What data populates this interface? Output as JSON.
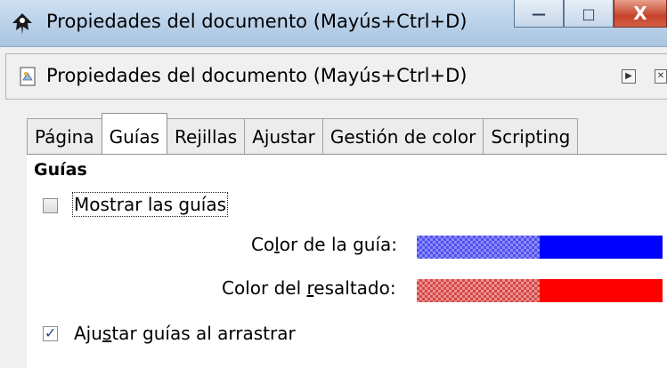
{
  "window": {
    "title": "Propiedades del documento (Mayús+Ctrl+D)",
    "buttons": {
      "minimize": "—",
      "maximize": "□",
      "close": "X"
    }
  },
  "panel": {
    "title": "Propiedades del documento (Mayús+Ctrl+D)"
  },
  "tabs": [
    {
      "label": "Página",
      "active": false
    },
    {
      "label": "Guías",
      "active": true
    },
    {
      "label": "Rejillas",
      "active": false
    },
    {
      "label": "Ajustar",
      "active": false
    },
    {
      "label": "Gestión de color",
      "active": false
    },
    {
      "label": "Scripting",
      "active": false
    }
  ],
  "guides": {
    "section_title": "Guías",
    "show_guides": {
      "label": "Mostrar las guías",
      "checked": false
    },
    "guide_color": {
      "label_pre": "Co",
      "label_u": "l",
      "label_post": "or de la guía:",
      "color": "#0000ff"
    },
    "highlight_color": {
      "label_pre": "Color del ",
      "label_u": "r",
      "label_post": "esaltado:",
      "color": "#ff0000"
    },
    "snap_guides": {
      "label_pre": "Aju",
      "label_u": "s",
      "label_post": "tar guías al arrastrar",
      "checked": true
    }
  }
}
